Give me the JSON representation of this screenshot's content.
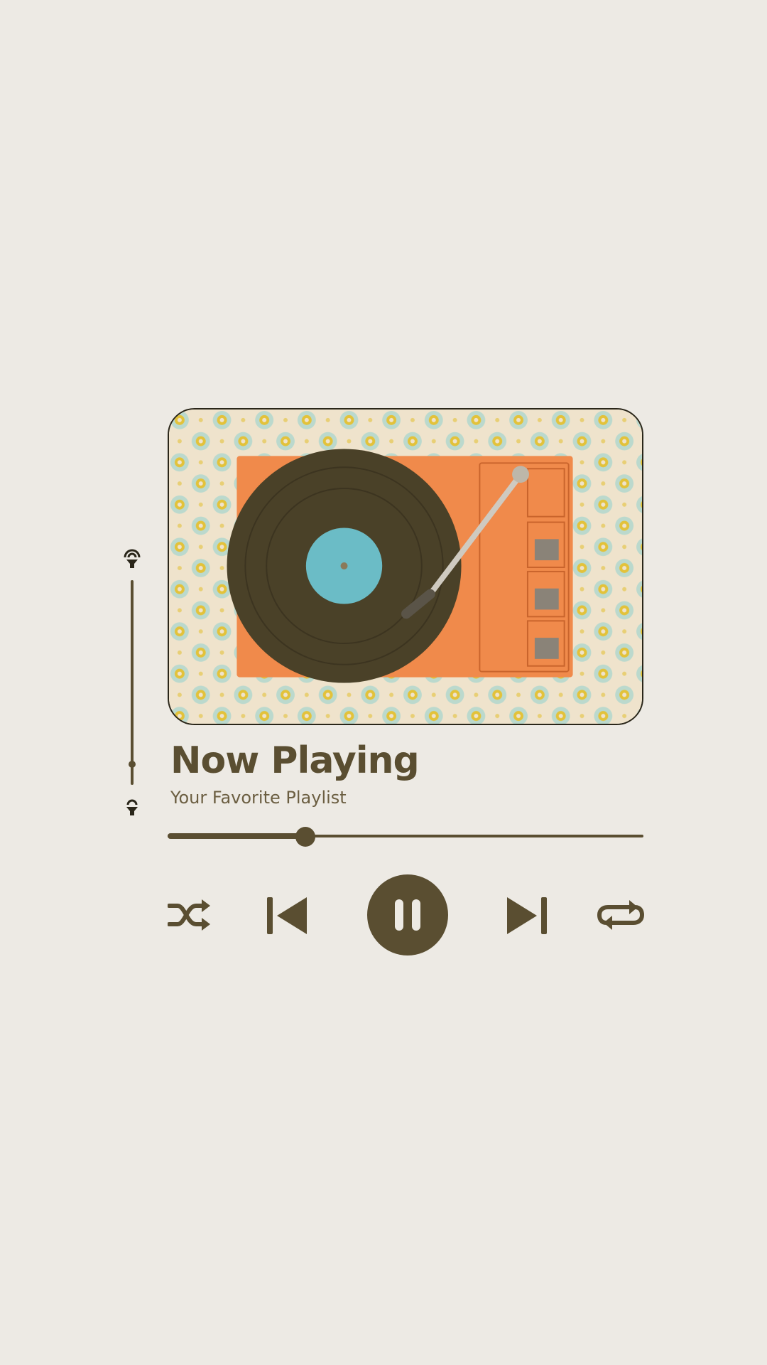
{
  "player": {
    "title": "Now Playing",
    "subtitle": "Your Favorite Playlist",
    "progress_fraction": 0.29,
    "volume_fraction": 0.1
  },
  "icons": {
    "volume_up": "speaker-loud-icon",
    "volume_down": "speaker-quiet-icon",
    "shuffle": "shuffle-icon",
    "previous": "skip-previous-icon",
    "pause": "pause-icon",
    "next": "skip-next-icon",
    "repeat": "repeat-icon"
  },
  "colors": {
    "background": "#edeae4",
    "accent": "#5a4e31",
    "turntable": "#f08a4b",
    "record": "#4a4128",
    "label": "#6bbcc6",
    "wallpaper": "#efe3cc"
  }
}
